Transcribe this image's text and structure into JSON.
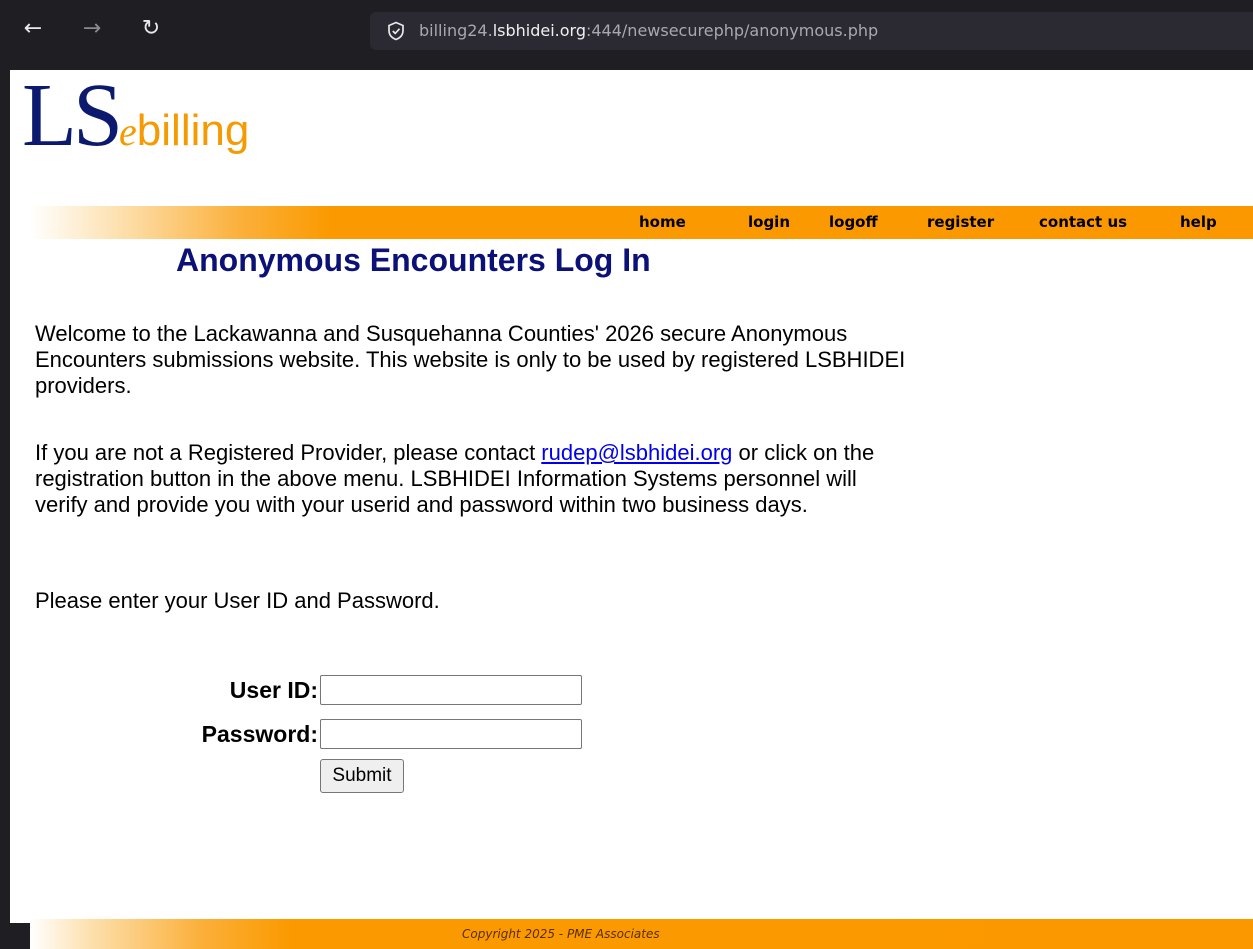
{
  "browser": {
    "back_icon": "←",
    "forward_icon": "→",
    "reload_icon": "↻",
    "url_prefix": "billing24.",
    "url_domain": "lsbhidei.org",
    "url_suffix": ":444/newsecurephp/anonymous.php"
  },
  "logo": {
    "ls": "LS",
    "e": "e",
    "billing": "billing"
  },
  "nav": {
    "home": "home",
    "login": "login",
    "logoff": "logoff",
    "register": "register",
    "contact": "contact us",
    "help": "help"
  },
  "heading": "Anonymous Encounters Log In",
  "intro": "Welcome to the Lackawanna and Susquehanna Counties' 2026 secure Anonymous Encounters submissions website. This website is only to be used by registered LSBHIDEI providers.",
  "contact": {
    "before": "If you are not a Registered Provider, please contact ",
    "email": "rudep@lsbhidei.org",
    "after": " or click on the registration button in the above menu.  LSBHIDEI Information Systems personnel will verify and provide you with your userid and password within two business days."
  },
  "instruction": "Please enter your User ID and Password.",
  "form": {
    "user_label": "User ID:",
    "user_value": "",
    "password_label": "Password:",
    "password_value": "",
    "submit_label": "Submit"
  },
  "footer": "Copyright 2025 - PME Associates",
  "colors": {
    "accent_orange": "#fb9800",
    "heading_blue": "#0b1176",
    "logo_blue": "#0b1a6e"
  }
}
